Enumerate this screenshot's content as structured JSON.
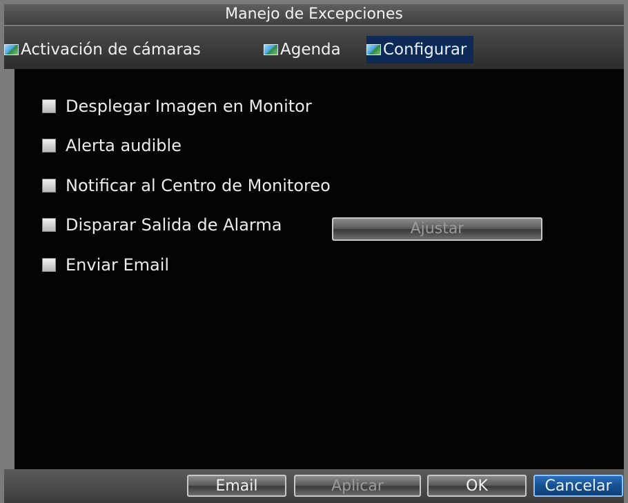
{
  "window": {
    "title": "Manejo de Excepciones"
  },
  "tabs": [
    {
      "label": "Activación de cámaras",
      "active": false,
      "icon": "image-icon"
    },
    {
      "label": "Agenda",
      "active": false,
      "icon": "image-icon"
    },
    {
      "label": "Configurar",
      "active": true,
      "icon": "image-icon"
    }
  ],
  "options": [
    {
      "label": "Desplegar Imagen en Monitor",
      "checked": false
    },
    {
      "label": "Alerta audible",
      "checked": false
    },
    {
      "label": "Notificar al Centro de Monitoreo",
      "checked": false
    },
    {
      "label": "Disparar Salida de Alarma",
      "checked": false
    },
    {
      "label": "Enviar Email",
      "checked": false
    }
  ],
  "alarm_button_label": "Ajustar",
  "footer": {
    "email_label": "Email",
    "apply_label": "Aplicar",
    "ok_label": "OK",
    "cancel_label": "Cancelar"
  },
  "colors": {
    "active_tab": "#0c2a55",
    "panel_background": "#040404",
    "cancel_button": "#17508f"
  }
}
